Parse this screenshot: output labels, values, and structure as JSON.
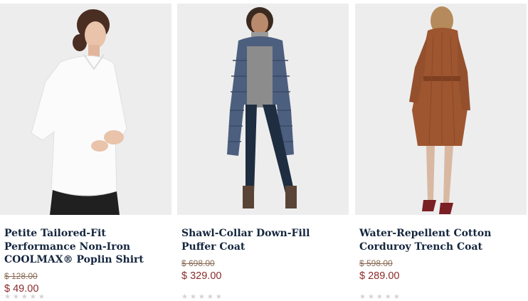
{
  "products": [
    {
      "name": "Petite Tailored-Fit Performance Non-Iron COOLMAX® Poplin Shirt",
      "original_price": "$ 128.00",
      "sale_price": "$ 49.00",
      "stars": "★★★★★"
    },
    {
      "name": "Shawl-Collar Down-Fill Puffer Coat",
      "original_price": "$ 698.00",
      "sale_price": "$ 329.00",
      "stars": "★★★★★"
    },
    {
      "name": "Water-Repellent Cotton Corduroy Trench Coat",
      "original_price": "$ 598.00",
      "sale_price": "$ 289.00",
      "stars": "★★★★★"
    }
  ],
  "colors": {
    "title": "#14263e",
    "sale": "#8b2a2a",
    "was": "#8a6a55",
    "image_bg": "#ededed"
  }
}
